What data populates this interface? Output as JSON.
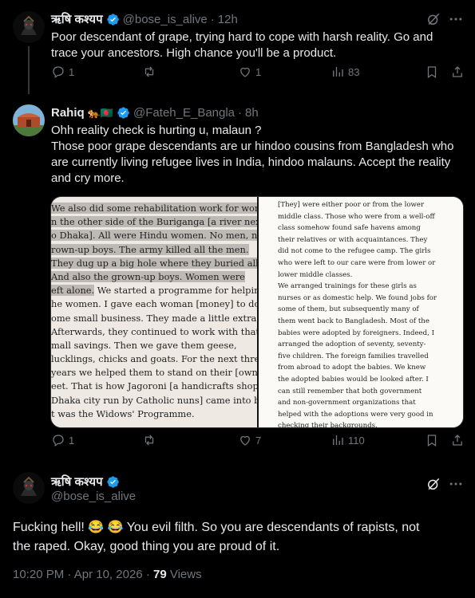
{
  "posts": [
    {
      "author_name": "ऋषि कश्यप",
      "handle": "@bose_is_alive",
      "time": "12h",
      "text_lines": [
        "Poor descendant of grape, trying hard to cope with harsh reality. Go and",
        "trace your ancestors. High chance you'll be a product."
      ],
      "replies": "1",
      "reposts": "",
      "likes": "1",
      "views": "83"
    },
    {
      "author_name": "Rahiq",
      "name_emojis": "🐅🇧🇩",
      "handle": "@Fateh_E_Bangla",
      "time": "8h",
      "text_lines": [
        "Ohh reality check is hurting u, malaun ?",
        "Those poor grape descendants are ur hindoo cousins from Bangladesh who",
        "are currently living refugee lives in India, hindoo malauns. Accept the reality",
        "and cry more."
      ],
      "replies": "1",
      "reposts": "",
      "likes": "7",
      "views": "110"
    }
  ],
  "media": {
    "left_page_lines": [
      "We also did some rehabilitation work for women",
      "n the other side of the Buriganga [a river next",
      "o Dhaka]. All were Hindu women. No men, no",
      "rown-up boys. The army killed all the men.",
      "They dug up a big hole where they buried all the men.",
      "And also the grown-up boys. Women were",
      "eft alone.",
      "he women. I gave each woman [money] to do",
      "ome small business. They made a little extra.",
      "Afterwards, they continued to work with that",
      "mall savings. Then we gave them geese,",
      "lucklings, chicks and goats. For the next three",
      "years we helped them to stand on their [own]",
      "eet. That is how Jagoroni [a handicrafts shop in",
      "Dhaka city run by Catholic nuns] came into being",
      "t was the Widows' Programme."
    ],
    "left_line7_rest": " We started a programme for helping",
    "right_page_lines": [
      "[They] were either poor or from the lower",
      "middle class. Those who were from a well-off",
      "class somehow found safe havens among",
      "their relatives or with acquaintances. They",
      "did not come to the refugee camp. The girls",
      "who were left to our care were from lower or",
      "lower middle classes.",
      "   We arranged trainings for these girls as",
      "nurses or as domestic help. We found jobs for",
      "some of them, but subsequently many of",
      "them went back to Bangladesh. Most of the",
      "babies were adopted by foreigners. Indeed, I",
      "arranged the adoption of seventy, seventy-",
      "five children. The foreign families travelled",
      "from abroad to adopt the babies. We knew",
      "the adopted babies would be looked after. I",
      "can still remember that both government",
      "and non-government organizations that",
      "helped with the adoptions were very good in",
      "checking their backgrounds."
    ]
  },
  "main_post": {
    "author_name": "ऋषि कश्यप",
    "handle": "@bose_is_alive",
    "text_lines": [
      "Fucking hell! 😂 😂 You evil filth. So you are descendants of rapists, not",
      "the raped. Okay, good thing you are proud of it."
    ],
    "time": "10:20 PM",
    "date": "Apr 10, 2026",
    "views_count": "79",
    "views_label": "Views"
  },
  "colors": {
    "background": "#000000",
    "text": "#e7e9ea",
    "muted": "#71767b",
    "verified": "#1d9bf0",
    "divider": "#2f3336"
  },
  "icons": [
    "verified-badge-icon",
    "grok-icon",
    "more-icon",
    "reply-icon",
    "repost-icon",
    "like-icon",
    "views-icon",
    "bookmark-icon",
    "share-icon"
  ]
}
